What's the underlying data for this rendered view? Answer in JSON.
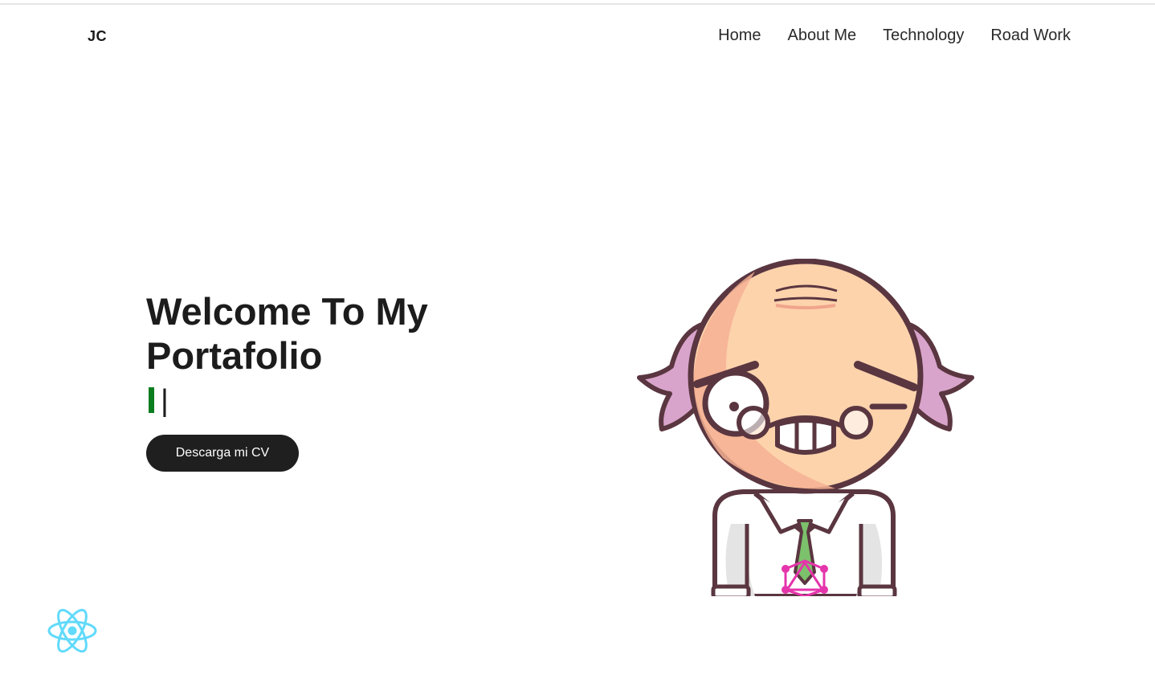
{
  "brand": {
    "logo_text": "JC"
  },
  "nav": {
    "items": [
      {
        "label": "Home"
      },
      {
        "label": "About Me"
      },
      {
        "label": "Technology"
      },
      {
        "label": "Road Work"
      }
    ]
  },
  "hero": {
    "title_line1": "Welcome To My",
    "title_line2": "Portafolio",
    "typing_cursor": "|",
    "cv_button_label": "Descarga mi CV"
  },
  "illustration": {
    "subject": "cartoon-scientist-avatar"
  },
  "icons": {
    "react": "react-logo-icon"
  },
  "colors": {
    "text": "#1c1c1c",
    "button_bg": "#1f1f1f",
    "button_text": "#ffffff",
    "typing_accent": "#0a7d1e",
    "react_blue": "#61dafb",
    "skin": "#fdd3ac",
    "hair": "#d9a4cb",
    "outline": "#5a3640",
    "tie": "#7cc16b",
    "graphql_pink": "#e535ab"
  }
}
